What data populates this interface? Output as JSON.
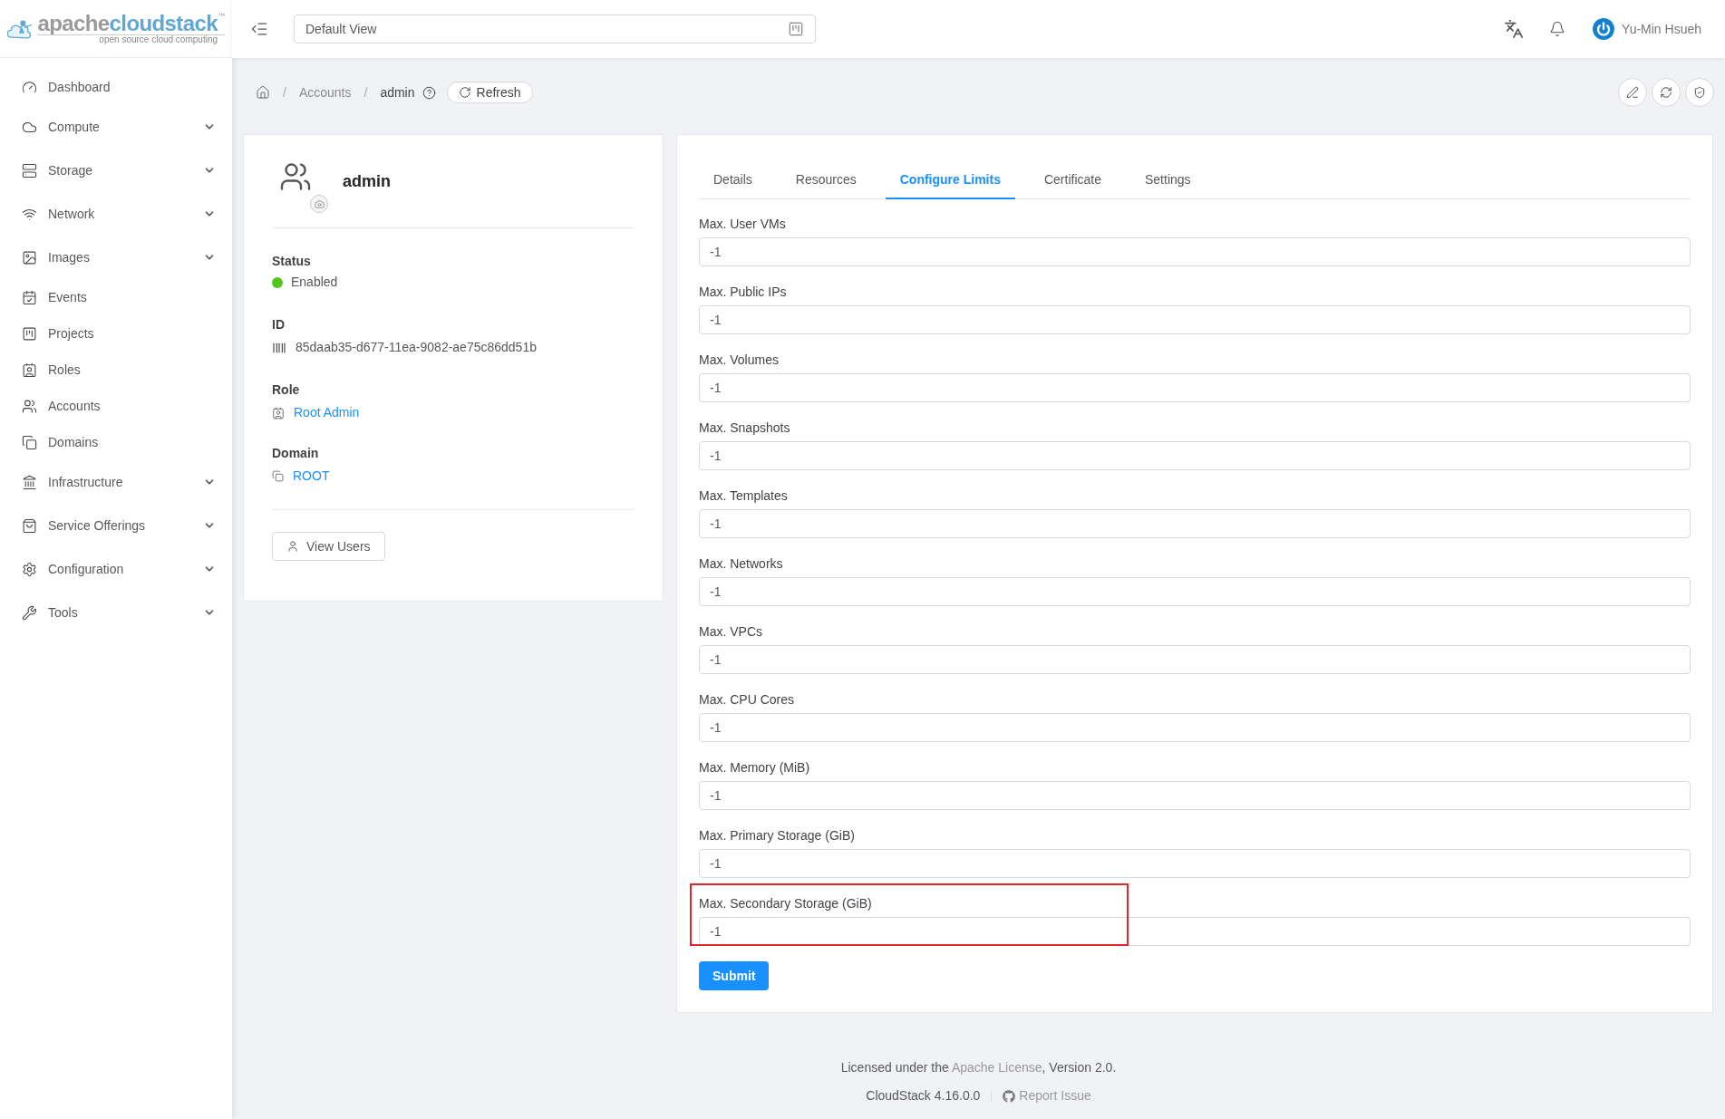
{
  "logo": {
    "word_grey": "apache",
    "word_blue": "cloudstack",
    "trademark": "™",
    "tagline": "open source cloud computing"
  },
  "header": {
    "view_selector": "Default View",
    "user_name": "Yu-Min Hsueh"
  },
  "sidebar": {
    "items": [
      {
        "label": "Dashboard",
        "expandable": false
      },
      {
        "label": "Compute",
        "expandable": true
      },
      {
        "label": "Storage",
        "expandable": true
      },
      {
        "label": "Network",
        "expandable": true
      },
      {
        "label": "Images",
        "expandable": true
      },
      {
        "label": "Events",
        "expandable": false
      },
      {
        "label": "Projects",
        "expandable": false
      },
      {
        "label": "Roles",
        "expandable": false
      },
      {
        "label": "Accounts",
        "expandable": false
      },
      {
        "label": "Domains",
        "expandable": false
      },
      {
        "label": "Infrastructure",
        "expandable": true
      },
      {
        "label": "Service Offerings",
        "expandable": true
      },
      {
        "label": "Configuration",
        "expandable": true
      },
      {
        "label": "Tools",
        "expandable": true
      }
    ]
  },
  "breadcrumb": {
    "separator": "/",
    "items": [
      "Accounts",
      "admin"
    ],
    "refresh_button": "Refresh"
  },
  "account": {
    "name": "admin",
    "status": {
      "label": "Status",
      "value": "Enabled",
      "color": "#52c41a"
    },
    "id": {
      "label": "ID",
      "value": "85daab35-d677-11ea-9082-ae75c86dd51b"
    },
    "role": {
      "label": "Role",
      "value": "Root Admin"
    },
    "domain": {
      "label": "Domain",
      "value": "ROOT"
    },
    "view_users_button": "View Users"
  },
  "tabs": [
    {
      "label": "Details",
      "selected": false
    },
    {
      "label": "Resources",
      "selected": false
    },
    {
      "label": "Configure Limits",
      "selected": true
    },
    {
      "label": "Certificate",
      "selected": false
    },
    {
      "label": "Settings",
      "selected": false
    }
  ],
  "limits": [
    {
      "label": "Max. User VMs",
      "value": "-1",
      "highlighted": false
    },
    {
      "label": "Max. Public IPs",
      "value": "-1",
      "highlighted": false
    },
    {
      "label": "Max. Volumes",
      "value": "-1",
      "highlighted": false
    },
    {
      "label": "Max. Snapshots",
      "value": "-1",
      "highlighted": false
    },
    {
      "label": "Max. Templates",
      "value": "-1",
      "highlighted": false
    },
    {
      "label": "Max. Networks",
      "value": "-1",
      "highlighted": false
    },
    {
      "label": "Max. VPCs",
      "value": "-1",
      "highlighted": false
    },
    {
      "label": "Max. CPU Cores",
      "value": "-1",
      "highlighted": false
    },
    {
      "label": "Max. Memory (MiB)",
      "value": "-1",
      "highlighted": false
    },
    {
      "label": "Max. Primary Storage (GiB)",
      "value": "-1",
      "highlighted": false
    },
    {
      "label": "Max. Secondary Storage (GiB)",
      "value": "-1",
      "highlighted": true
    }
  ],
  "submit_button": "Submit",
  "footer": {
    "license_before": "Licensed under the ",
    "license_link": "Apache License",
    "license_after": ", Version 2.0.",
    "version": "CloudStack 4.16.0.0",
    "report_link": "Report Issue"
  }
}
